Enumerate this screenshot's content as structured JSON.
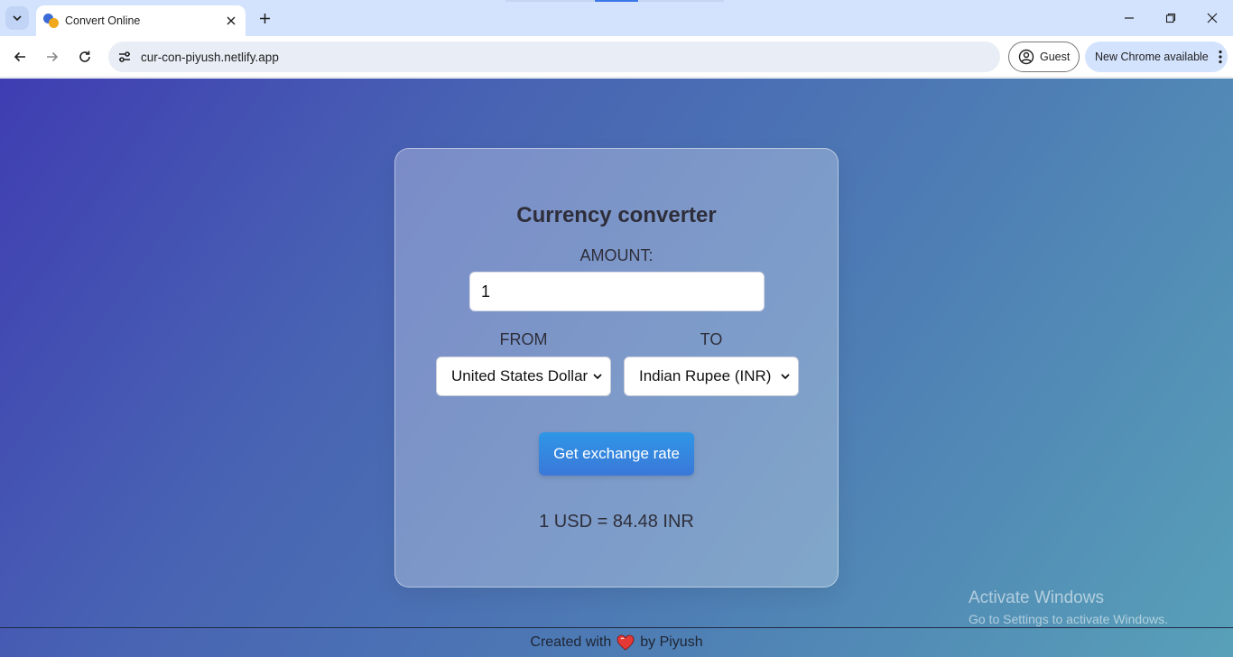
{
  "browser": {
    "tab_title": "Convert Online",
    "url": "cur-con-piyush.netlify.app",
    "profile_label": "Guest",
    "update_label": "New Chrome available"
  },
  "app": {
    "title": "Currency converter",
    "amount_label": "AMOUNT:",
    "amount_value": "1",
    "from_label": "FROM",
    "from_value": "United States Dollar",
    "to_label": "TO",
    "to_value": "Indian Rupee (INR)",
    "button_label": "Get exchange rate",
    "result": "1 USD = 84.48 INR"
  },
  "footer": {
    "prefix": "Created with",
    "suffix": "by Piyush"
  },
  "watermark": {
    "line1": "Activate Windows",
    "line2": "Go to Settings to activate Windows."
  },
  "colors": {
    "accent_button": "#3a86df",
    "heart": "#e53935"
  }
}
